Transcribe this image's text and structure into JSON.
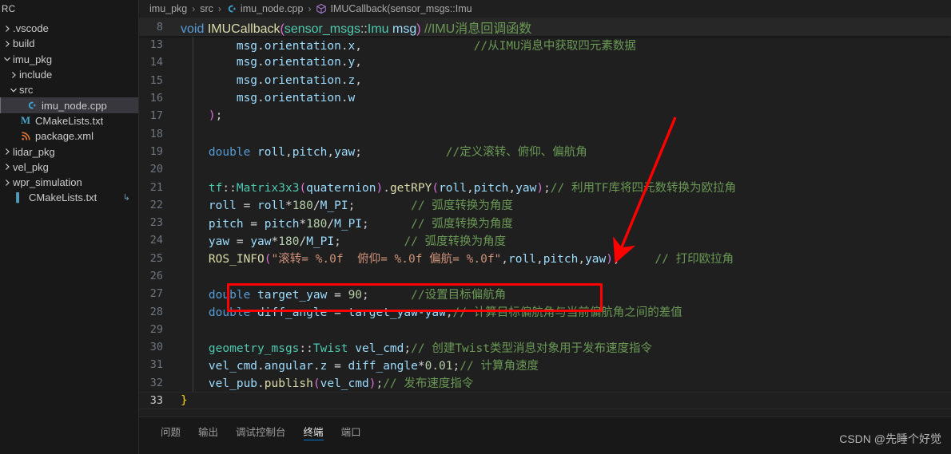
{
  "sidebar": {
    "title": "RC",
    "items": [
      {
        "label": ".vscode",
        "twisty": "right",
        "icon": "folder",
        "indent": 0,
        "selected": false
      },
      {
        "label": "build",
        "twisty": "right",
        "icon": "folder",
        "indent": 0,
        "selected": false
      },
      {
        "label": "imu_pkg",
        "twisty": "down",
        "icon": "folder",
        "indent": 0,
        "selected": false
      },
      {
        "label": "include",
        "twisty": "right",
        "icon": "folder",
        "indent": 1,
        "selected": false
      },
      {
        "label": "src",
        "twisty": "down",
        "icon": "folder",
        "indent": 1,
        "selected": false
      },
      {
        "label": "imu_node.cpp",
        "twisty": "none",
        "icon": "cpp-file-icon",
        "indent": 2,
        "selected": true
      },
      {
        "label": "CMakeLists.txt",
        "twisty": "none",
        "icon": "cmake-file-icon",
        "indent": 1,
        "selected": false
      },
      {
        "label": "package.xml",
        "twisty": "none",
        "icon": "xml-file-icon",
        "indent": 1,
        "selected": false
      },
      {
        "label": "lidar_pkg",
        "twisty": "right",
        "icon": "folder",
        "indent": 0,
        "selected": false
      },
      {
        "label": "vel_pkg",
        "twisty": "right",
        "icon": "folder",
        "indent": 0,
        "selected": false
      },
      {
        "label": "wpr_simulation",
        "twisty": "right",
        "icon": "folder",
        "indent": 0,
        "selected": false
      },
      {
        "label": "CMakeLists.txt",
        "twisty": "none",
        "icon": "cmake2-file-icon",
        "indent": 0,
        "selected": false,
        "trailing": "↳"
      }
    ]
  },
  "breadcrumb": {
    "parts": [
      {
        "label": "imu_pkg",
        "icon": "none"
      },
      {
        "label": "src",
        "icon": "none"
      },
      {
        "label": "imu_node.cpp",
        "icon": "cpp-file-icon"
      },
      {
        "label": "IMUCallback(sensor_msgs::Imu",
        "icon": "method-cube-icon"
      }
    ],
    "separator": "›"
  },
  "sticky_line": {
    "number": "8",
    "tokens": [
      {
        "t": "    ",
        "c": "op"
      },
      {
        "t": "void",
        "c": "kw"
      },
      {
        "t": " ",
        "c": "op"
      },
      {
        "t": "IMUCallback",
        "c": "fn"
      },
      {
        "t": "(",
        "c": "paren"
      },
      {
        "t": "sensor_msgs",
        "c": "typ"
      },
      {
        "t": "::",
        "c": "pun"
      },
      {
        "t": "Imu",
        "c": "typ"
      },
      {
        "t": " msg",
        "c": "var"
      },
      {
        "t": ")",
        "c": "paren"
      },
      {
        "t": "   ",
        "c": "op"
      },
      {
        "t": "//IMU消息回调函数",
        "c": "cmt"
      }
    ]
  },
  "code_lines": [
    {
      "number": "13",
      "current": false,
      "tokens": [
        {
          "t": "        ",
          "c": "op"
        },
        {
          "t": "msg",
          "c": "var"
        },
        {
          "t": ".",
          "c": "pun"
        },
        {
          "t": "orientation",
          "c": "var"
        },
        {
          "t": ".",
          "c": "pun"
        },
        {
          "t": "x",
          "c": "var"
        },
        {
          "t": ",",
          "c": "pun"
        },
        {
          "t": "                ",
          "c": "op"
        },
        {
          "t": "//从IMU消息中获取四元素数据",
          "c": "cmt"
        }
      ]
    },
    {
      "number": "14",
      "current": false,
      "tokens": [
        {
          "t": "        ",
          "c": "op"
        },
        {
          "t": "msg",
          "c": "var"
        },
        {
          "t": ".",
          "c": "pun"
        },
        {
          "t": "orientation",
          "c": "var"
        },
        {
          "t": ".",
          "c": "pun"
        },
        {
          "t": "y",
          "c": "var"
        },
        {
          "t": ",",
          "c": "pun"
        }
      ]
    },
    {
      "number": "15",
      "current": false,
      "tokens": [
        {
          "t": "        ",
          "c": "op"
        },
        {
          "t": "msg",
          "c": "var"
        },
        {
          "t": ".",
          "c": "pun"
        },
        {
          "t": "orientation",
          "c": "var"
        },
        {
          "t": ".",
          "c": "pun"
        },
        {
          "t": "z",
          "c": "var"
        },
        {
          "t": ",",
          "c": "pun"
        }
      ]
    },
    {
      "number": "16",
      "current": false,
      "tokens": [
        {
          "t": "        ",
          "c": "op"
        },
        {
          "t": "msg",
          "c": "var"
        },
        {
          "t": ".",
          "c": "pun"
        },
        {
          "t": "orientation",
          "c": "var"
        },
        {
          "t": ".",
          "c": "pun"
        },
        {
          "t": "w",
          "c": "var"
        }
      ]
    },
    {
      "number": "17",
      "current": false,
      "tokens": [
        {
          "t": "    ",
          "c": "op"
        },
        {
          "t": ")",
          "c": "paren"
        },
        {
          "t": ";",
          "c": "pun"
        }
      ]
    },
    {
      "number": "18",
      "current": false,
      "tokens": []
    },
    {
      "number": "19",
      "current": false,
      "tokens": [
        {
          "t": "    ",
          "c": "op"
        },
        {
          "t": "double",
          "c": "kw"
        },
        {
          "t": " ",
          "c": "op"
        },
        {
          "t": "roll",
          "c": "var"
        },
        {
          "t": ",",
          "c": "pun"
        },
        {
          "t": "pitch",
          "c": "var"
        },
        {
          "t": ",",
          "c": "pun"
        },
        {
          "t": "yaw",
          "c": "var"
        },
        {
          "t": ";",
          "c": "pun"
        },
        {
          "t": "            ",
          "c": "op"
        },
        {
          "t": "//定义滚转、俯仰、偏航角",
          "c": "cmt"
        }
      ]
    },
    {
      "number": "20",
      "current": false,
      "tokens": []
    },
    {
      "number": "21",
      "current": false,
      "tokens": [
        {
          "t": "    ",
          "c": "op"
        },
        {
          "t": "tf",
          "c": "typ"
        },
        {
          "t": "::",
          "c": "pun"
        },
        {
          "t": "Matrix3x3",
          "c": "typ"
        },
        {
          "t": "(",
          "c": "paren"
        },
        {
          "t": "quaternion",
          "c": "var"
        },
        {
          "t": ")",
          "c": "paren"
        },
        {
          "t": ".",
          "c": "pun"
        },
        {
          "t": "getRPY",
          "c": "fn"
        },
        {
          "t": "(",
          "c": "paren"
        },
        {
          "t": "roll",
          "c": "var"
        },
        {
          "t": ",",
          "c": "pun"
        },
        {
          "t": "pitch",
          "c": "var"
        },
        {
          "t": ",",
          "c": "pun"
        },
        {
          "t": "yaw",
          "c": "var"
        },
        {
          "t": ")",
          "c": "paren"
        },
        {
          "t": ";",
          "c": "pun"
        },
        {
          "t": "// 利用TF库将四元数转换为欧拉角",
          "c": "cmt"
        }
      ]
    },
    {
      "number": "22",
      "current": false,
      "tokens": [
        {
          "t": "    ",
          "c": "op"
        },
        {
          "t": "roll",
          "c": "var"
        },
        {
          "t": " = ",
          "c": "op"
        },
        {
          "t": "roll",
          "c": "var"
        },
        {
          "t": "*",
          "c": "op"
        },
        {
          "t": "180",
          "c": "num"
        },
        {
          "t": "/",
          "c": "op"
        },
        {
          "t": "M_PI",
          "c": "var"
        },
        {
          "t": ";",
          "c": "pun"
        },
        {
          "t": "        ",
          "c": "op"
        },
        {
          "t": "// 弧度转换为角度",
          "c": "cmt"
        }
      ]
    },
    {
      "number": "23",
      "current": false,
      "tokens": [
        {
          "t": "    ",
          "c": "op"
        },
        {
          "t": "pitch",
          "c": "var"
        },
        {
          "t": " = ",
          "c": "op"
        },
        {
          "t": "pitch",
          "c": "var"
        },
        {
          "t": "*",
          "c": "op"
        },
        {
          "t": "180",
          "c": "num"
        },
        {
          "t": "/",
          "c": "op"
        },
        {
          "t": "M_PI",
          "c": "var"
        },
        {
          "t": ";",
          "c": "pun"
        },
        {
          "t": "      ",
          "c": "op"
        },
        {
          "t": "// 弧度转换为角度",
          "c": "cmt"
        }
      ]
    },
    {
      "number": "24",
      "current": false,
      "tokens": [
        {
          "t": "    ",
          "c": "op"
        },
        {
          "t": "yaw",
          "c": "var"
        },
        {
          "t": " = ",
          "c": "op"
        },
        {
          "t": "yaw",
          "c": "var"
        },
        {
          "t": "*",
          "c": "op"
        },
        {
          "t": "180",
          "c": "num"
        },
        {
          "t": "/",
          "c": "op"
        },
        {
          "t": "M_PI",
          "c": "var"
        },
        {
          "t": ";",
          "c": "pun"
        },
        {
          "t": "         ",
          "c": "op"
        },
        {
          "t": "// 弧度转换为角度",
          "c": "cmt"
        }
      ]
    },
    {
      "number": "25",
      "current": false,
      "tokens": [
        {
          "t": "    ",
          "c": "op"
        },
        {
          "t": "ROS_INFO",
          "c": "fn"
        },
        {
          "t": "(",
          "c": "paren"
        },
        {
          "t": "\"滚转= %.0f  俯仰= %.0f 偏航= %.0f\"",
          "c": "str"
        },
        {
          "t": ",",
          "c": "pun"
        },
        {
          "t": "roll",
          "c": "var"
        },
        {
          "t": ",",
          "c": "pun"
        },
        {
          "t": "pitch",
          "c": "var"
        },
        {
          "t": ",",
          "c": "pun"
        },
        {
          "t": "yaw",
          "c": "var"
        },
        {
          "t": ")",
          "c": "paren"
        },
        {
          "t": ";",
          "c": "pun"
        },
        {
          "t": "     ",
          "c": "op"
        },
        {
          "t": "// 打印欧拉角",
          "c": "cmt"
        }
      ]
    },
    {
      "number": "26",
      "current": false,
      "tokens": []
    },
    {
      "number": "27",
      "current": false,
      "tokens": [
        {
          "t": "    ",
          "c": "op"
        },
        {
          "t": "double",
          "c": "kw"
        },
        {
          "t": " ",
          "c": "op"
        },
        {
          "t": "target_yaw",
          "c": "var"
        },
        {
          "t": " = ",
          "c": "op"
        },
        {
          "t": "90",
          "c": "num"
        },
        {
          "t": ";",
          "c": "pun"
        },
        {
          "t": "      ",
          "c": "op"
        },
        {
          "t": "//设置目标偏航角",
          "c": "cmt"
        }
      ]
    },
    {
      "number": "28",
      "current": false,
      "tokens": [
        {
          "t": "    ",
          "c": "op"
        },
        {
          "t": "double",
          "c": "kw"
        },
        {
          "t": " ",
          "c": "op"
        },
        {
          "t": "diff_angle",
          "c": "var"
        },
        {
          "t": " = ",
          "c": "op"
        },
        {
          "t": "target_yaw",
          "c": "var"
        },
        {
          "t": "-",
          "c": "op"
        },
        {
          "t": "yaw",
          "c": "var"
        },
        {
          "t": ";",
          "c": "pun"
        },
        {
          "t": "// 计算目标偏航角与当前偏航角之间的差值",
          "c": "cmt"
        }
      ]
    },
    {
      "number": "29",
      "current": false,
      "tokens": []
    },
    {
      "number": "30",
      "current": false,
      "tokens": [
        {
          "t": "    ",
          "c": "op"
        },
        {
          "t": "geometry_msgs",
          "c": "typ"
        },
        {
          "t": "::",
          "c": "pun"
        },
        {
          "t": "Twist",
          "c": "typ"
        },
        {
          "t": " ",
          "c": "op"
        },
        {
          "t": "vel_cmd",
          "c": "var"
        },
        {
          "t": ";",
          "c": "pun"
        },
        {
          "t": "// 创建Twist类型消息对象用于发布速度指令",
          "c": "cmt"
        }
      ]
    },
    {
      "number": "31",
      "current": false,
      "tokens": [
        {
          "t": "    ",
          "c": "op"
        },
        {
          "t": "vel_cmd",
          "c": "var"
        },
        {
          "t": ".",
          "c": "pun"
        },
        {
          "t": "angular",
          "c": "var"
        },
        {
          "t": ".",
          "c": "pun"
        },
        {
          "t": "z",
          "c": "var"
        },
        {
          "t": " = ",
          "c": "op"
        },
        {
          "t": "diff_angle",
          "c": "var"
        },
        {
          "t": "*",
          "c": "op"
        },
        {
          "t": "0.01",
          "c": "num"
        },
        {
          "t": ";",
          "c": "pun"
        },
        {
          "t": "// 计算角速度",
          "c": "cmt"
        }
      ]
    },
    {
      "number": "32",
      "current": false,
      "tokens": [
        {
          "t": "    ",
          "c": "op"
        },
        {
          "t": "vel_pub",
          "c": "var"
        },
        {
          "t": ".",
          "c": "pun"
        },
        {
          "t": "publish",
          "c": "fn"
        },
        {
          "t": "(",
          "c": "paren"
        },
        {
          "t": "vel_cmd",
          "c": "var"
        },
        {
          "t": ")",
          "c": "paren"
        },
        {
          "t": ";",
          "c": "pun"
        },
        {
          "t": "// 发布速度指令",
          "c": "cmt"
        }
      ]
    },
    {
      "number": "33",
      "current": true,
      "tokens": [
        {
          "t": "}",
          "c": "brace"
        }
      ]
    }
  ],
  "annotations": {
    "box_color": "#ff0000",
    "arrow_color": "#ff0000",
    "highlighted_line": "27"
  },
  "panel": {
    "tabs": [
      {
        "label": "问题",
        "active": false
      },
      {
        "label": "输出",
        "active": false
      },
      {
        "label": "调试控制台",
        "active": false
      },
      {
        "label": "终端",
        "active": true
      },
      {
        "label": "端口",
        "active": false
      }
    ]
  },
  "watermark": {
    "text": "CSDN @先睡个好觉"
  }
}
